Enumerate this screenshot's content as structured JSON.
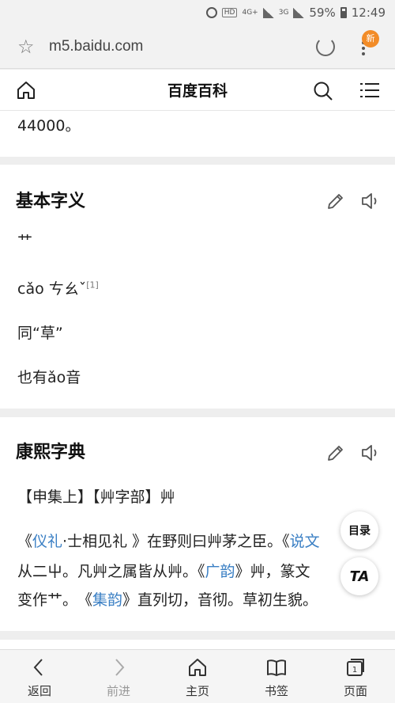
{
  "status_bar": {
    "hd": "HD",
    "net1": "4G+",
    "net2": "3G",
    "battery": "59%",
    "time": "12:49"
  },
  "browser": {
    "url": "m5.baidu.com",
    "new_badge": "新"
  },
  "header": {
    "title": "百度百科"
  },
  "content": {
    "top_text": "44000。",
    "section1": {
      "heading": "基本字义",
      "char": "艹",
      "pinyin": "cǎo ㄘㄠˇ",
      "ref": "[1]",
      "line2": "同“草”",
      "line3": "也有ǎo音"
    },
    "section2": {
      "heading": "康熙字典",
      "line1": "【申集上】【艸字部】艸",
      "p1_a": "《",
      "p1_link1": "仪礼",
      "p1_b": "·士相见礼 》在野则曰艸茅之臣。《",
      "p1_link2": "说文",
      "p2_a": "从二屮。凡艸之属皆从艸。《",
      "p2_link": "广韵",
      "p2_b": "》艸，篆文",
      "p3_a": "变作艹。　《",
      "p3_link": "集韵",
      "p3_b": "》直列切，音彻。草初生貌。"
    }
  },
  "floating": {
    "toc": "目录",
    "ta": "TA"
  },
  "bottom_nav": {
    "back": "返回",
    "forward": "前进",
    "home": "主页",
    "bookmarks": "书签",
    "pages": "页面",
    "pages_count": "1"
  }
}
